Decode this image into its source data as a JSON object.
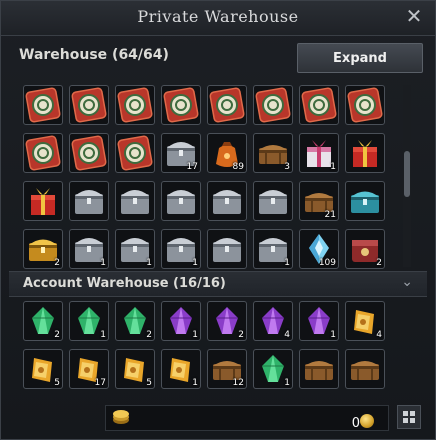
{
  "window": {
    "title": "Private Warehouse",
    "close_icon": "close-icon"
  },
  "warehouse": {
    "title": "Warehouse (64/64)",
    "expand_label": "Expand",
    "slots": [
      {
        "icon": "emblem-card",
        "qty": ""
      },
      {
        "icon": "emblem-card",
        "qty": ""
      },
      {
        "icon": "emblem-card",
        "qty": ""
      },
      {
        "icon": "emblem-card",
        "qty": ""
      },
      {
        "icon": "emblem-card",
        "qty": ""
      },
      {
        "icon": "emblem-card",
        "qty": ""
      },
      {
        "icon": "emblem-card",
        "qty": ""
      },
      {
        "icon": "emblem-card",
        "qty": ""
      },
      {
        "icon": "emblem-card",
        "qty": ""
      },
      {
        "icon": "emblem-card",
        "qty": ""
      },
      {
        "icon": "emblem-card",
        "qty": ""
      },
      {
        "icon": "silver-chest",
        "qty": "17"
      },
      {
        "icon": "orange-pouch",
        "qty": "89"
      },
      {
        "icon": "wooden-chest",
        "qty": "3"
      },
      {
        "icon": "pink-gift-box",
        "qty": "1"
      },
      {
        "icon": "red-gift-box",
        "qty": ""
      },
      {
        "icon": "red-gift-box",
        "qty": ""
      },
      {
        "icon": "silver-chest",
        "qty": ""
      },
      {
        "icon": "silver-chest",
        "qty": ""
      },
      {
        "icon": "silver-chest",
        "qty": ""
      },
      {
        "icon": "silver-chest",
        "qty": ""
      },
      {
        "icon": "silver-chest",
        "qty": ""
      },
      {
        "icon": "wooden-chest",
        "qty": "21"
      },
      {
        "icon": "teal-chest",
        "qty": ""
      },
      {
        "icon": "gold-chest",
        "qty": "2"
      },
      {
        "icon": "silver-chest",
        "qty": "1"
      },
      {
        "icon": "silver-chest",
        "qty": "1"
      },
      {
        "icon": "silver-chest",
        "qty": "1"
      },
      {
        "icon": "silver-chest",
        "qty": ""
      },
      {
        "icon": "silver-chest",
        "qty": "1"
      },
      {
        "icon": "blue-crystal",
        "qty": "109"
      },
      {
        "icon": "red-box",
        "qty": "2"
      }
    ]
  },
  "account_warehouse": {
    "title": "Account Warehouse (16/16)",
    "slots": [
      {
        "icon": "green-gem",
        "qty": "2"
      },
      {
        "icon": "green-gem",
        "qty": "1"
      },
      {
        "icon": "green-gem",
        "qty": "2"
      },
      {
        "icon": "purple-gem",
        "qty": "1"
      },
      {
        "icon": "purple-gem",
        "qty": "2"
      },
      {
        "icon": "purple-gem",
        "qty": "4"
      },
      {
        "icon": "purple-gem",
        "qty": "1"
      },
      {
        "icon": "gold-scroll",
        "qty": "4"
      },
      {
        "icon": "gold-scroll",
        "qty": "5"
      },
      {
        "icon": "gold-scroll",
        "qty": "17"
      },
      {
        "icon": "gold-scroll",
        "qty": "5"
      },
      {
        "icon": "gold-scroll",
        "qty": "1"
      },
      {
        "icon": "wooden-chest",
        "qty": "12"
      },
      {
        "icon": "green-gem",
        "qty": "1"
      },
      {
        "icon": "wooden-chest",
        "qty": ""
      },
      {
        "icon": "wooden-chest",
        "qty": ""
      }
    ]
  },
  "footer": {
    "coin_amount": "0",
    "coin_icon": "coin-icon",
    "deposit_icon": "coin-stack-icon",
    "grid_icon": "grid-view-icon"
  }
}
